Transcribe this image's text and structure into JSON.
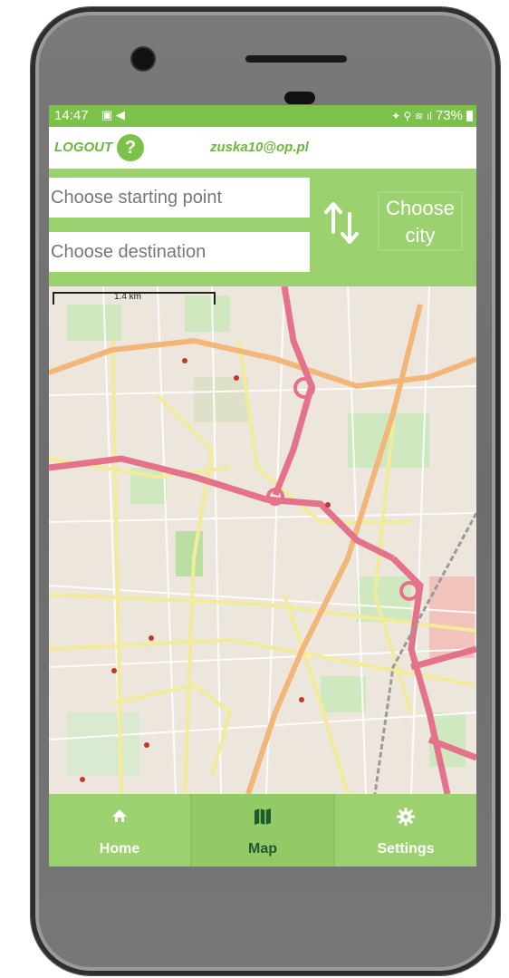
{
  "status": {
    "time": "14:47",
    "battery": "73%"
  },
  "header": {
    "logout_label": "LOGOUT",
    "help_symbol": "?",
    "user_email": "zuska10@op.pl"
  },
  "route": {
    "start_placeholder": "Choose starting point",
    "destination_placeholder": "Choose destination",
    "city_button_label": "Choose city"
  },
  "map": {
    "scale_label": "1.4 km"
  },
  "nav": {
    "items": [
      {
        "label": "Home",
        "icon": "home-icon",
        "active": false
      },
      {
        "label": "Map",
        "icon": "map-icon",
        "active": true
      },
      {
        "label": "Settings",
        "icon": "gear-icon",
        "active": false
      }
    ]
  },
  "colors": {
    "accent": "#7cc149",
    "panel": "#9bd16e",
    "active_label": "#1d5b2c"
  }
}
